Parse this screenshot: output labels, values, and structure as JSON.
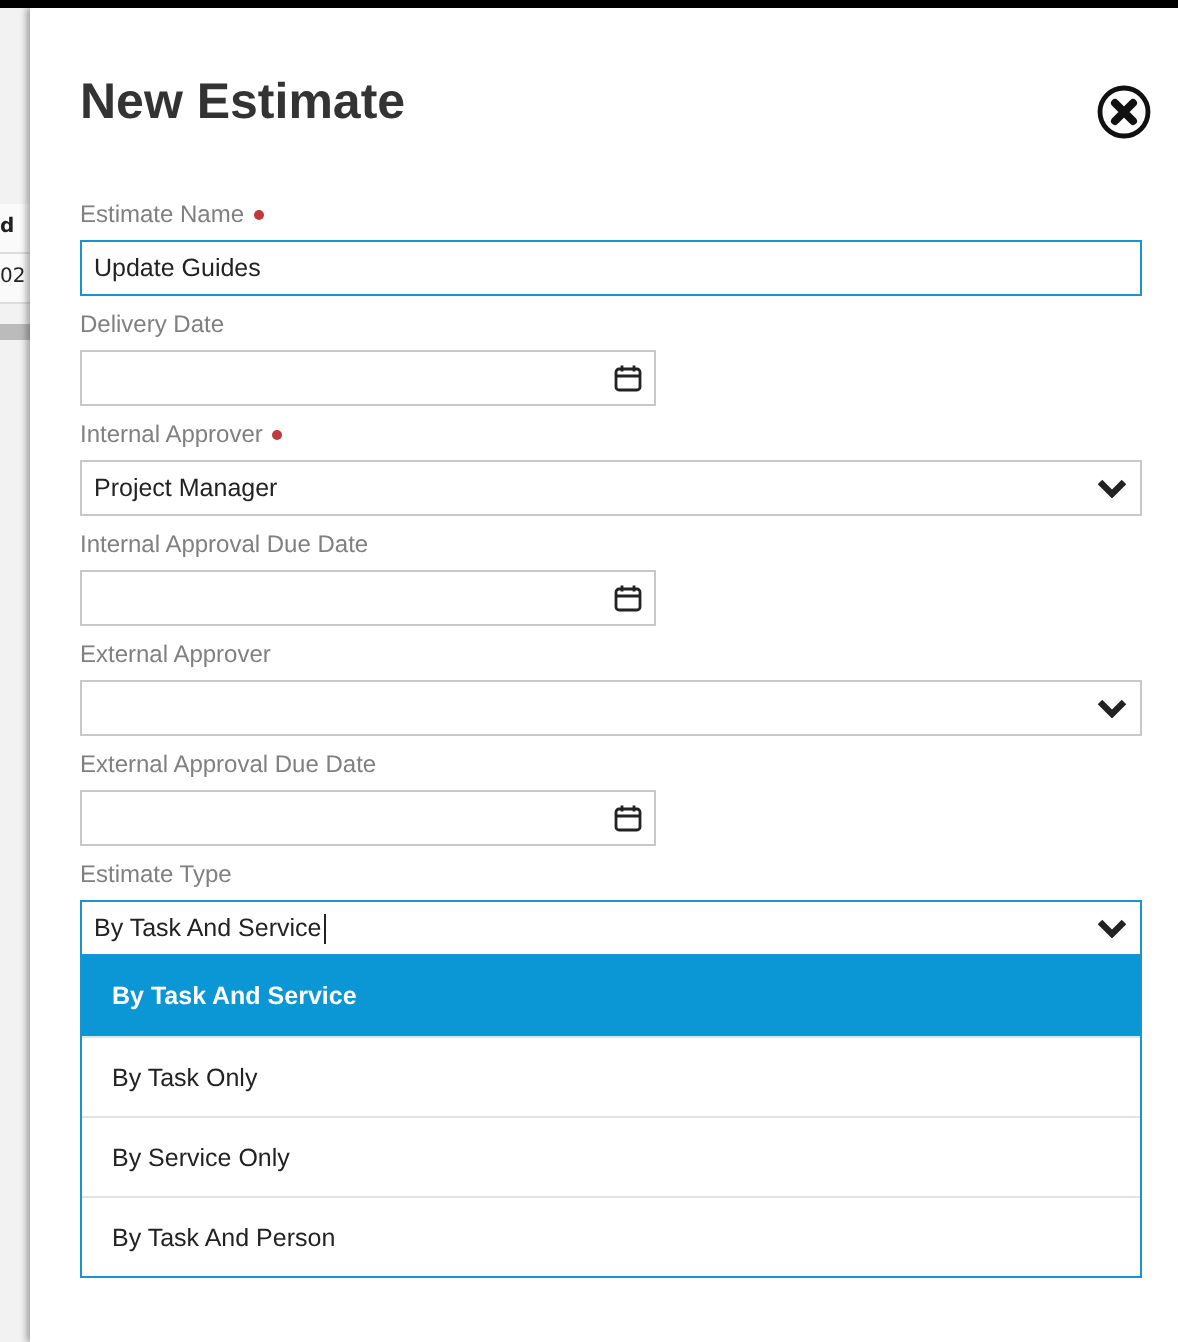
{
  "background_page": {
    "texts": [
      "d",
      "02"
    ]
  },
  "dialog": {
    "title": "New Estimate"
  },
  "fields": [
    {
      "kind": "text",
      "label": "Estimate Name",
      "required": true,
      "value": "Update Guides",
      "focused": true
    },
    {
      "kind": "date",
      "label": "Delivery Date",
      "required": false,
      "focused": false
    },
    {
      "kind": "select",
      "label": "Internal Approver",
      "required": true,
      "value": "Project Manager",
      "focused": false
    },
    {
      "kind": "date",
      "label": "Internal Approval Due Date",
      "required": false,
      "focused": false
    },
    {
      "kind": "select",
      "label": "External Approver",
      "required": false,
      "focused": false
    },
    {
      "kind": "date",
      "label": "External Approval Due Date",
      "required": false,
      "focused": false
    },
    {
      "kind": "select",
      "label": "Estimate Type",
      "required": false,
      "value": "By Task And Service",
      "focused": true,
      "expanded": true,
      "options": [
        {
          "label": "By Task And Service",
          "selected": true
        },
        {
          "label": "By Task Only",
          "selected": false
        },
        {
          "label": "By Service Only",
          "selected": false
        },
        {
          "label": "By Task And Person",
          "selected": false
        }
      ]
    }
  ]
}
